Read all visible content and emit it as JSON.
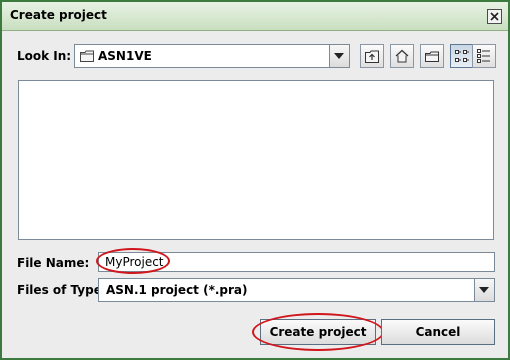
{
  "window": {
    "title": "Create project"
  },
  "look_in": {
    "label": "Look In:",
    "value": "ASN1VE"
  },
  "toolbar": {
    "icons": [
      "up-folder-icon",
      "home-icon",
      "new-folder-icon",
      "list-view-icon",
      "details-view-icon"
    ]
  },
  "file_name": {
    "label": "File Name:",
    "value": "MyProject"
  },
  "files_of_type": {
    "label": "Files of Type:",
    "value": "ASN.1 project (*.pra)"
  },
  "buttons": {
    "create": "Create project",
    "cancel": "Cancel"
  },
  "colors": {
    "title_bar": "#c9dfc0",
    "window_border": "#3d7a3d",
    "highlight_ellipse": "#d0161c"
  }
}
